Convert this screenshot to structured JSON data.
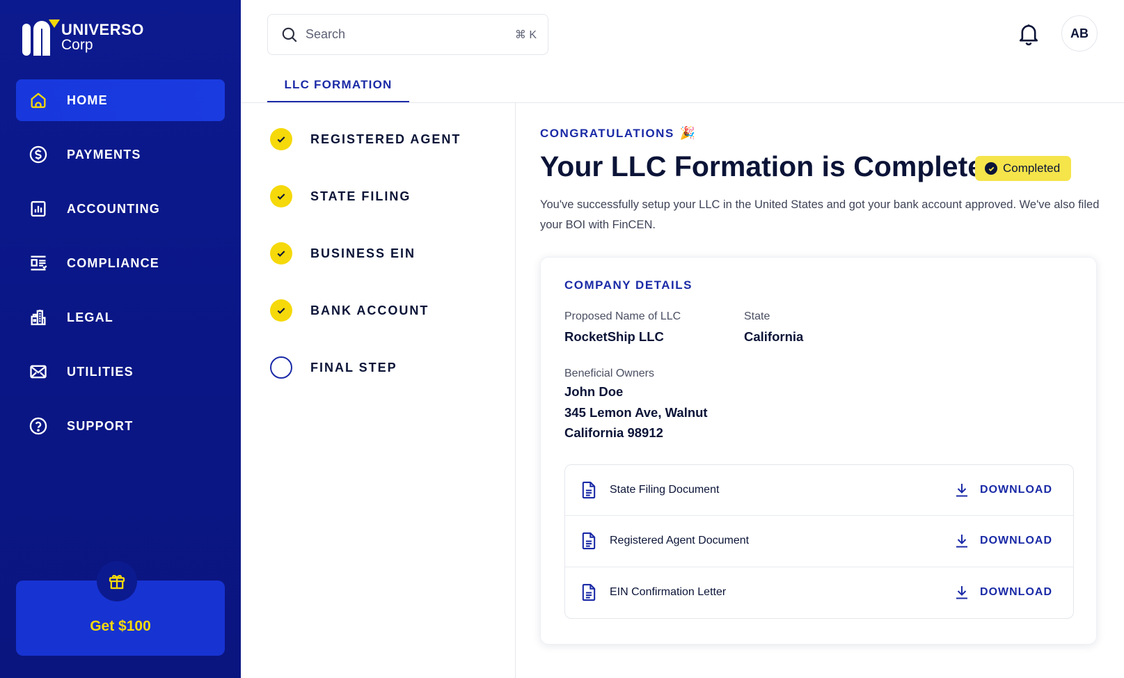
{
  "brand": {
    "line1": "UNIVERSO",
    "line2": "Corp",
    "accent": "#f5d90a",
    "sidebar_bg": "#0c1a8f"
  },
  "sidebar": {
    "items": [
      {
        "label": "HOME",
        "icon": "home-icon",
        "active": true
      },
      {
        "label": "PAYMENTS",
        "icon": "dollar-circle-icon"
      },
      {
        "label": "ACCOUNTING",
        "icon": "bar-chart-icon"
      },
      {
        "label": "COMPLIANCE",
        "icon": "checklist-icon"
      },
      {
        "label": "LEGAL",
        "icon": "bank-building-icon"
      },
      {
        "label": "UTILITIES",
        "icon": "mail-icon"
      },
      {
        "label": "SUPPORT",
        "icon": "help-circle-icon"
      }
    ],
    "promo": {
      "label": "Get $100",
      "icon": "gift-icon"
    }
  },
  "topbar": {
    "search_placeholder": "Search",
    "search_shortcut": "⌘ K",
    "avatar_initials": "AB"
  },
  "tabs": [
    {
      "label": "LLC FORMATION",
      "active": true
    }
  ],
  "steps": [
    {
      "label": "REGISTERED AGENT",
      "done": true
    },
    {
      "label": "STATE FILING",
      "done": true
    },
    {
      "label": "BUSINESS EIN",
      "done": true
    },
    {
      "label": "BANK ACCOUNT",
      "done": true
    },
    {
      "label": "FINAL STEP",
      "done": false
    }
  ],
  "main": {
    "eyebrow": "CONGRATULATIONS",
    "eyebrow_emoji": "🎉",
    "headline": "Your LLC Formation is Complete",
    "status_badge": "Completed",
    "description": "You've successfully setup your LLC in the United States and got your bank account approved. We've also filed your BOI with FinCEN."
  },
  "company": {
    "title": "COMPANY DETAILS",
    "name_label": "Proposed Name of LLC",
    "name_value": "RocketShip LLC",
    "state_label": "State",
    "state_value": "California",
    "owners_label": "Beneficial Owners",
    "owner_name": "John Doe",
    "owner_address1": "345 Lemon Ave, Walnut",
    "owner_address2": "California 98912"
  },
  "documents": [
    {
      "name": "State Filing Document",
      "action": "DOWNLOAD"
    },
    {
      "name": "Registered Agent Document",
      "action": "DOWNLOAD"
    },
    {
      "name": "EIN Confirmation Letter",
      "action": "DOWNLOAD"
    }
  ]
}
